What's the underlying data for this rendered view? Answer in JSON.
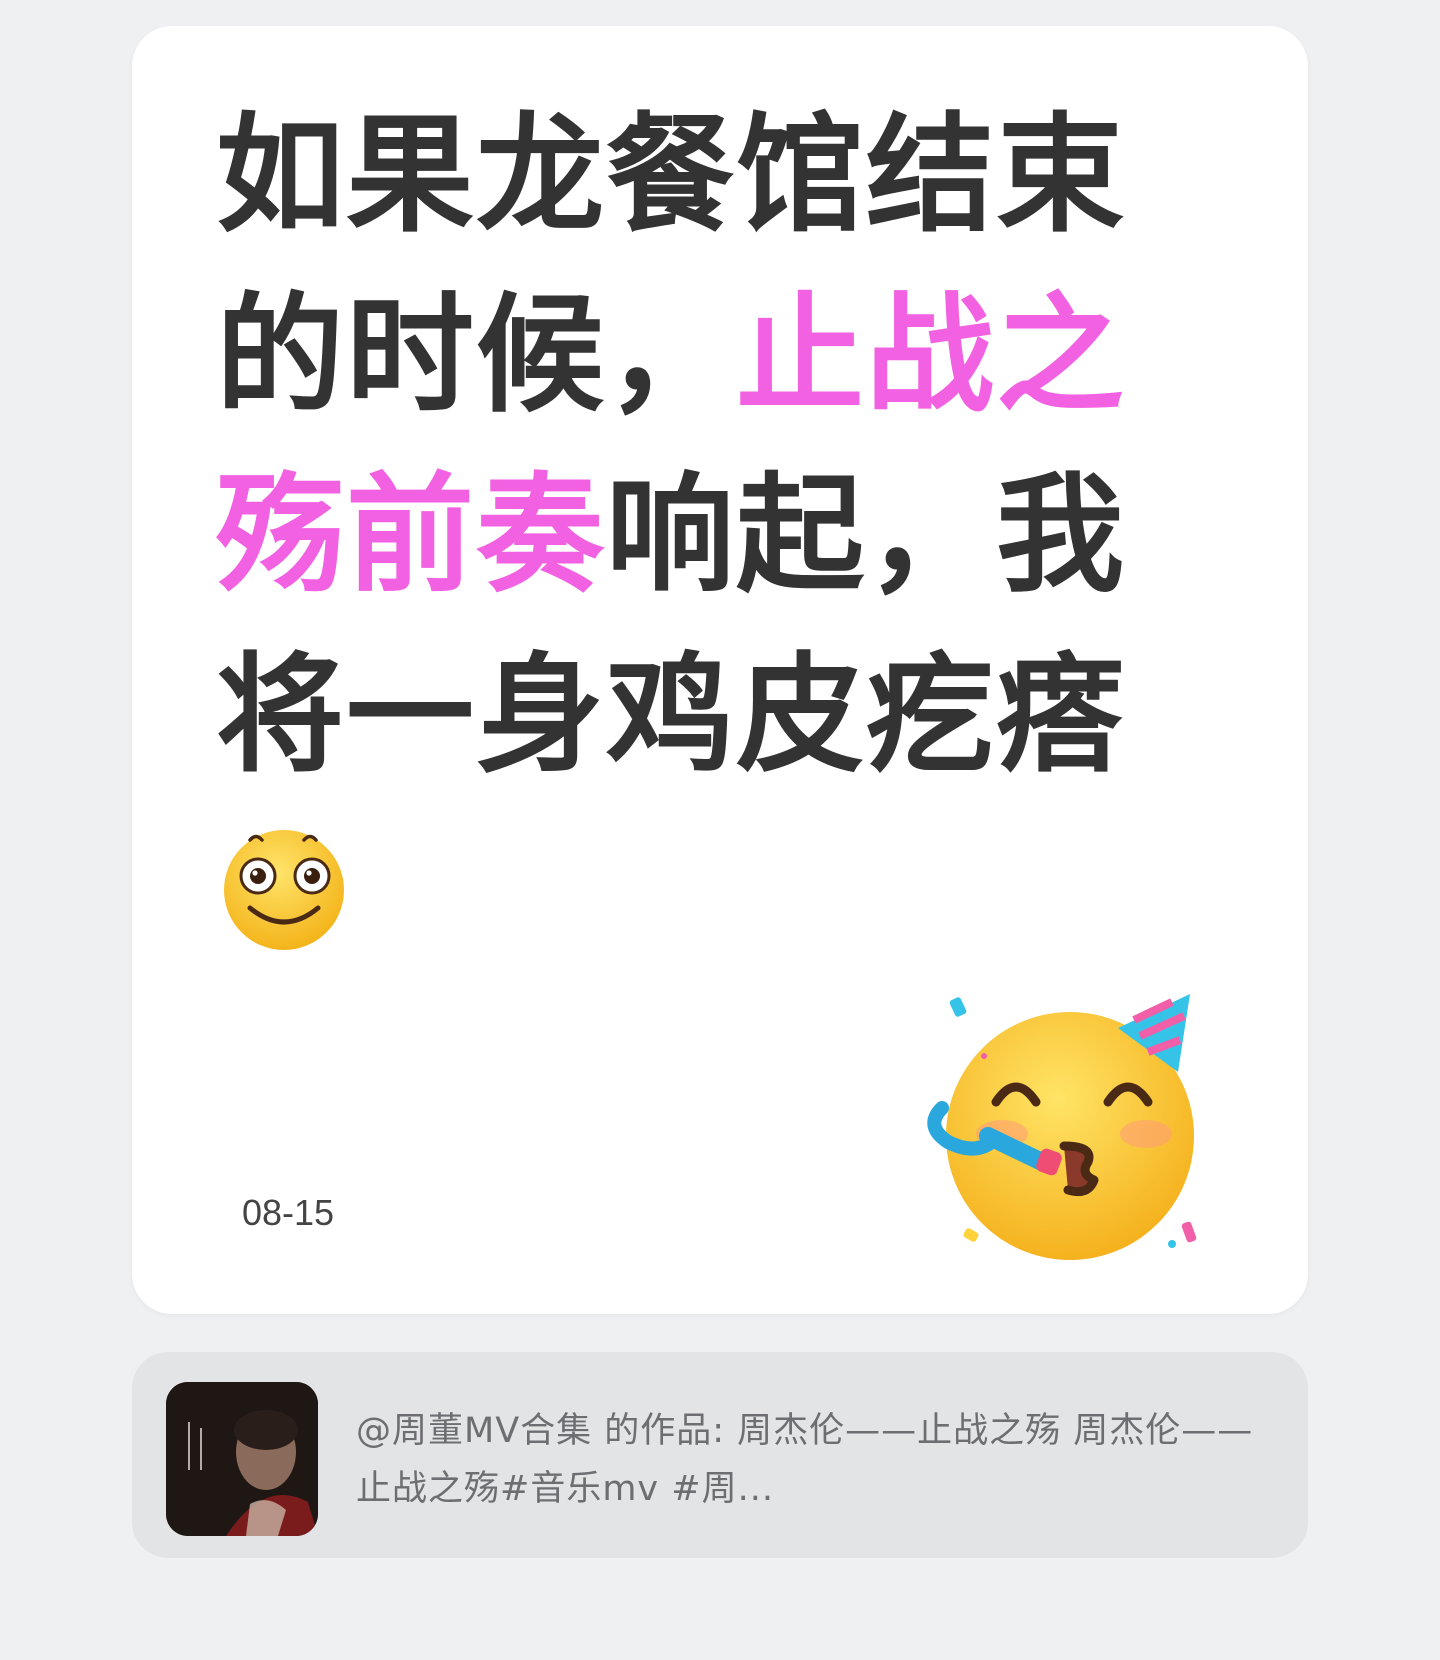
{
  "note": {
    "text_line1": "如果龙餐馆结束",
    "text_line2a": "的时候，",
    "text_line2b": "止战之",
    "text_line3a": "殇前奏",
    "text_line3b": "响起，我",
    "text_line4": "将一身鸡皮疙瘩",
    "highlight_color": "#f261e2",
    "date": "08-15",
    "emoji_1": "smiling-face-emoji",
    "emoji_2": "partying-face-emoji"
  },
  "share": {
    "text": "@周董MV合集 的作品: 周杰伦——止战之殇 周杰伦——止战之殇#音乐mv #周...",
    "thumbnail": "video-thumbnail"
  }
}
